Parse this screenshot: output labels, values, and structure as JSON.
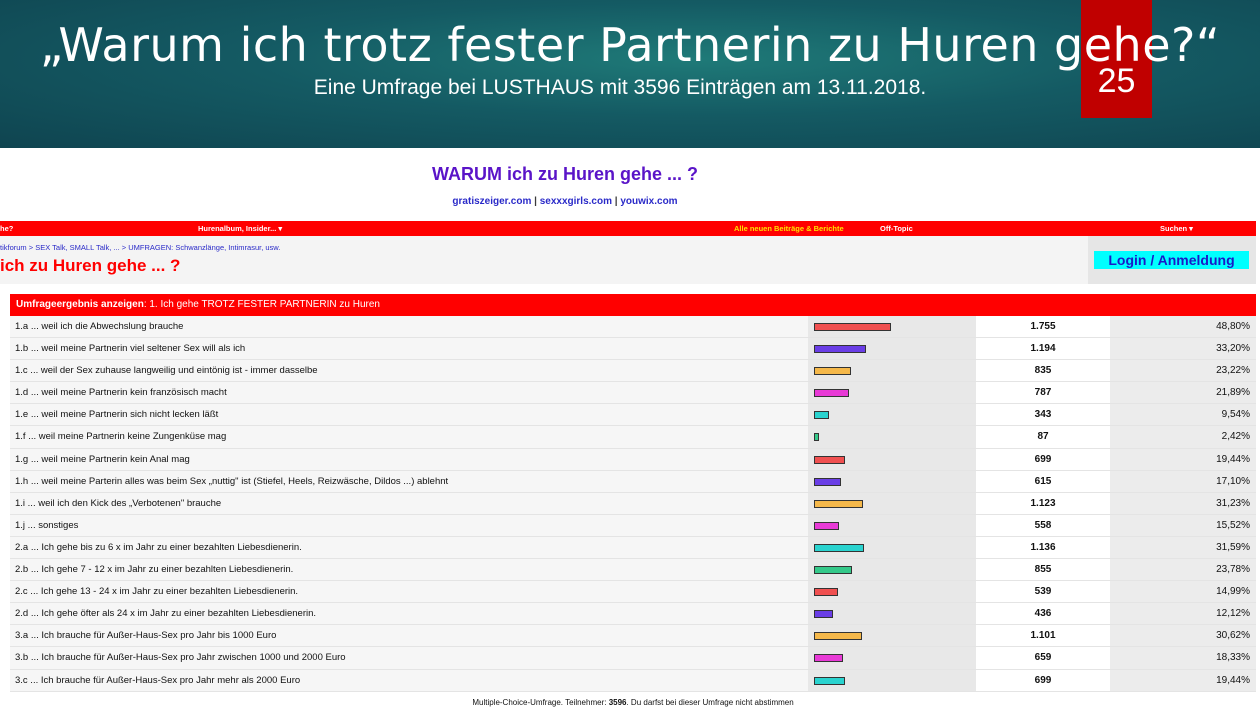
{
  "slide": {
    "title": "„Warum ich trotz fester Partnerin zu Huren gehe?“",
    "subtitle": "Eine Umfrage bei LUSTHAUS mit 3596 Einträgen am 13.11.2018.",
    "page_number": "25",
    "badge_color": "#c00000"
  },
  "forum": {
    "heading": "WARUM ich zu Huren gehe ... ?",
    "links": [
      "gratiszeiger.com",
      "sexxxgirls.com",
      "youwix.com"
    ],
    "link_separator": " | ",
    "navbar": {
      "left": "he?",
      "album": "Hurenalbum, Insider... ▾",
      "new_posts": "Alle neuen Beiträge & Berichte",
      "off_topic": "Off-Topic",
      "search": "Suchen ▾"
    },
    "breadcrumb": "tikforum > SEX Talk, SMALL Talk, ... > UMFRAGEN: Schwanzlänge, Intimrasur, usw.",
    "thread_title": "ich zu Huren gehe ... ?",
    "login_label": "Login / Anmeldung",
    "accent_color": "#ff0000"
  },
  "poll": {
    "header_bold": "Umfrageergebnis anzeigen",
    "header_rest": ": 1. Ich gehe TROTZ FESTER PARTNERIN zu Huren",
    "rows": [
      {
        "label": "1.a ... weil ich die Abwechslung brauche",
        "count": "1.755",
        "percent": "48,80%",
        "value": 48.8,
        "color": "#f05050"
      },
      {
        "label": "1.b ... weil meine Partnerin viel seltener Sex will als ich",
        "count": "1.194",
        "percent": "33,20%",
        "value": 33.2,
        "color": "#6a3ee6"
      },
      {
        "label": "1.c ... weil der Sex zuhause langweilig und eintönig ist - immer dasselbe",
        "count": "835",
        "percent": "23,22%",
        "value": 23.22,
        "color": "#f5b84a"
      },
      {
        "label": "1.d ... weil meine Partnerin kein französisch macht",
        "count": "787",
        "percent": "21,89%",
        "value": 21.89,
        "color": "#e83ad6"
      },
      {
        "label": "1.e ... weil meine Partnerin sich nicht lecken läßt",
        "count": "343",
        "percent": "9,54%",
        "value": 9.54,
        "color": "#2ad3cf"
      },
      {
        "label": "1.f ... weil meine Partnerin keine Zungenküse mag",
        "count": "87",
        "percent": "2,42%",
        "value": 2.42,
        "color": "#35c98a"
      },
      {
        "label": "1.g ... weil meine Partnerin kein Anal mag",
        "count": "699",
        "percent": "19,44%",
        "value": 19.44,
        "color": "#f05050"
      },
      {
        "label": "1.h ... weil meine Parterin alles was beim Sex „nuttig\" ist (Stiefel, Heels, Reizwäsche, Dildos ...) ablehnt",
        "count": "615",
        "percent": "17,10%",
        "value": 17.1,
        "color": "#6a3ee6"
      },
      {
        "label": "1.i ... weil ich den Kick des „Verbotenen\" brauche",
        "count": "1.123",
        "percent": "31,23%",
        "value": 31.23,
        "color": "#f5b84a"
      },
      {
        "label": "1.j ... sonstiges",
        "count": "558",
        "percent": "15,52%",
        "value": 15.52,
        "color": "#e83ad6"
      },
      {
        "label": "2.a ... Ich gehe bis zu 6 x im Jahr zu einer bezahlten Liebesdienerin.",
        "count": "1.136",
        "percent": "31,59%",
        "value": 31.59,
        "color": "#2ad3cf"
      },
      {
        "label": "2.b ... Ich gehe 7 - 12 x im Jahr zu einer bezahlten Liebesdienerin.",
        "count": "855",
        "percent": "23,78%",
        "value": 23.78,
        "color": "#35c98a"
      },
      {
        "label": "2.c ... Ich gehe 13 - 24 x im Jahr zu einer bezahlten Liebesdienerin.",
        "count": "539",
        "percent": "14,99%",
        "value": 14.99,
        "color": "#f05050"
      },
      {
        "label": "2.d ... Ich gehe öfter als 24 x im Jahr zu einer bezahlten Liebesdienerin.",
        "count": "436",
        "percent": "12,12%",
        "value": 12.12,
        "color": "#6a3ee6"
      },
      {
        "label": "3.a ... Ich brauche für Außer-Haus-Sex pro Jahr bis 1000 Euro",
        "count": "1.101",
        "percent": "30,62%",
        "value": 30.62,
        "color": "#f5b84a"
      },
      {
        "label": "3.b ... Ich brauche für Außer-Haus-Sex pro Jahr zwischen 1000 und 2000 Euro",
        "count": "659",
        "percent": "18,33%",
        "value": 18.33,
        "color": "#e83ad6"
      },
      {
        "label": "3.c ... Ich brauche für Außer-Haus-Sex pro Jahr mehr als 2000 Euro",
        "count": "699",
        "percent": "19,44%",
        "value": 19.44,
        "color": "#2ad3cf"
      }
    ],
    "footer_pre": "Multiple-Choice-Umfrage. Teilnehmer: ",
    "footer_count": "3596",
    "footer_post": ". Du darfst bei dieser Umfrage nicht abstimmen"
  }
}
